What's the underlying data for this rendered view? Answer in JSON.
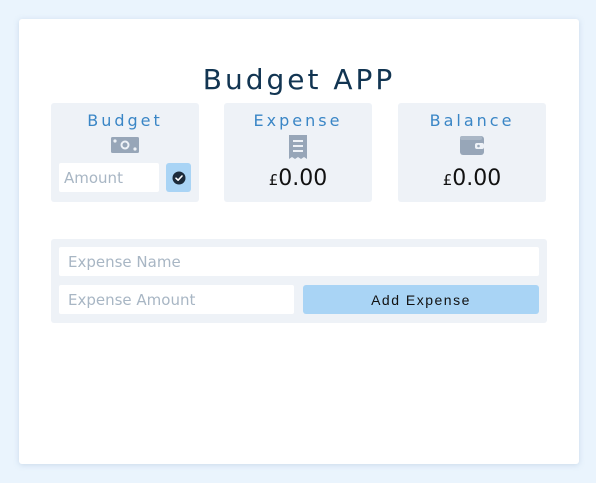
{
  "app": {
    "title": "Budget APP"
  },
  "budget": {
    "title": "Budget",
    "icon": "money-bill-icon",
    "input_placeholder": "Amount",
    "submit_icon": "check-circle-icon"
  },
  "expense": {
    "title": "Expense",
    "icon": "receipt-icon",
    "currency": "£",
    "amount": "0.00"
  },
  "balance": {
    "title": "Balance",
    "icon": "wallet-icon",
    "currency": "£",
    "amount": "0.00"
  },
  "form": {
    "name_placeholder": "Expense Name",
    "amount_placeholder": "Expense Amount",
    "add_label": "Add Expense"
  },
  "colors": {
    "background": "#eaf4fd",
    "title": "#123552",
    "box_title": "#3a86c6",
    "button": "#a9d4f5",
    "panel": "#eef2f7",
    "icon": "#97a6b8"
  }
}
